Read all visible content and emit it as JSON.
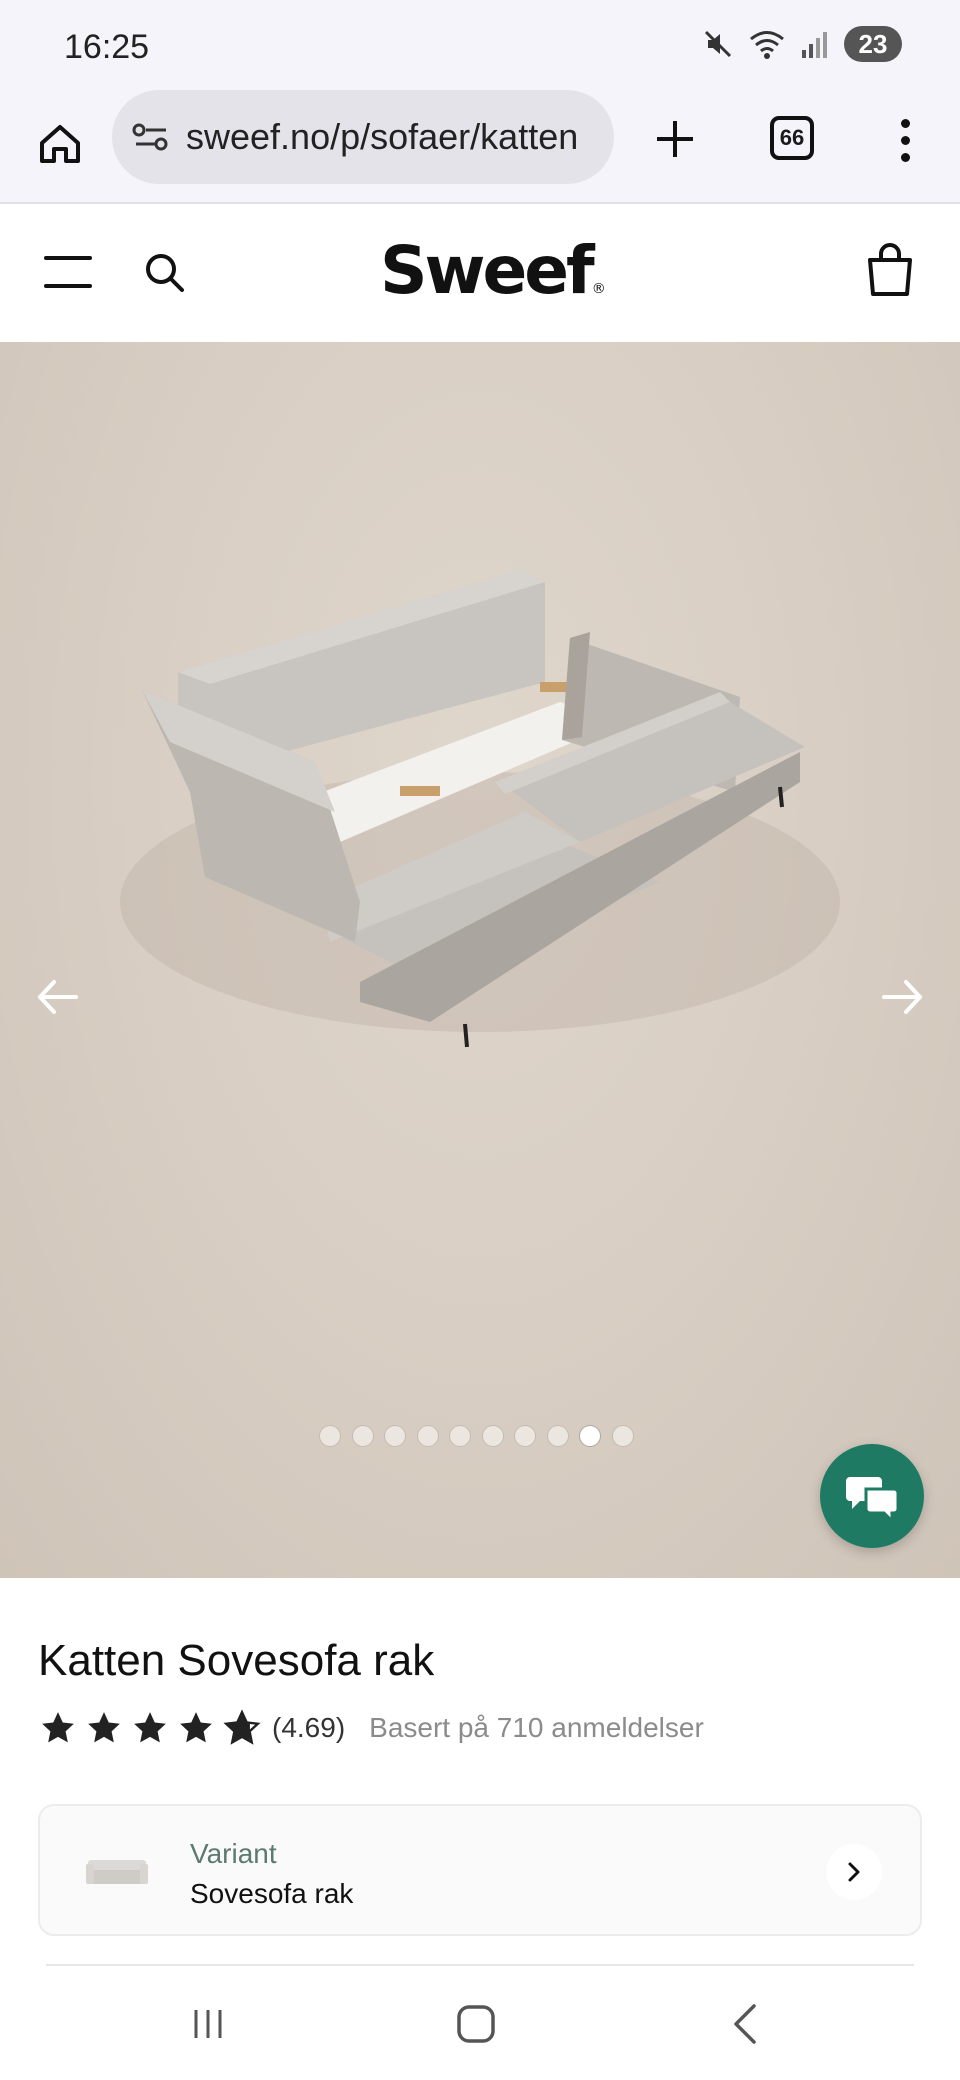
{
  "status": {
    "time": "16:25",
    "battery": "23",
    "icons": [
      "mute-icon",
      "wifi-icon",
      "signal-icon",
      "battery-icon"
    ]
  },
  "browser": {
    "url": "sweef.no/p/sofaer/katten",
    "tab_count": "66",
    "icons": [
      "home-icon",
      "site-settings-icon",
      "new-tab-icon",
      "tab-switcher-icon",
      "more-menu-icon"
    ]
  },
  "header": {
    "logo": "Sweef",
    "logo_mark": "®",
    "icons": [
      "menu-icon",
      "search-icon",
      "cart-icon"
    ]
  },
  "gallery": {
    "slide_count": 10,
    "active_index": 8,
    "icons": [
      "arrow-left-icon",
      "arrow-right-icon",
      "chat-icon"
    ]
  },
  "product": {
    "title": "Katten Sovesofa rak",
    "rating": 4.69,
    "rating_text": "(4.69)",
    "rating_count_text": "Basert på 710 anmeldelser",
    "variant_label": "Variant",
    "variant_value": "Sovesofa rak"
  },
  "colors": {
    "accent_green": "#1f7a64",
    "variant_label": "#5b7a70",
    "hero_bg": "#d9cfc4"
  },
  "nav": {
    "icons": [
      "recents-icon",
      "home-nav-icon",
      "back-icon"
    ]
  }
}
